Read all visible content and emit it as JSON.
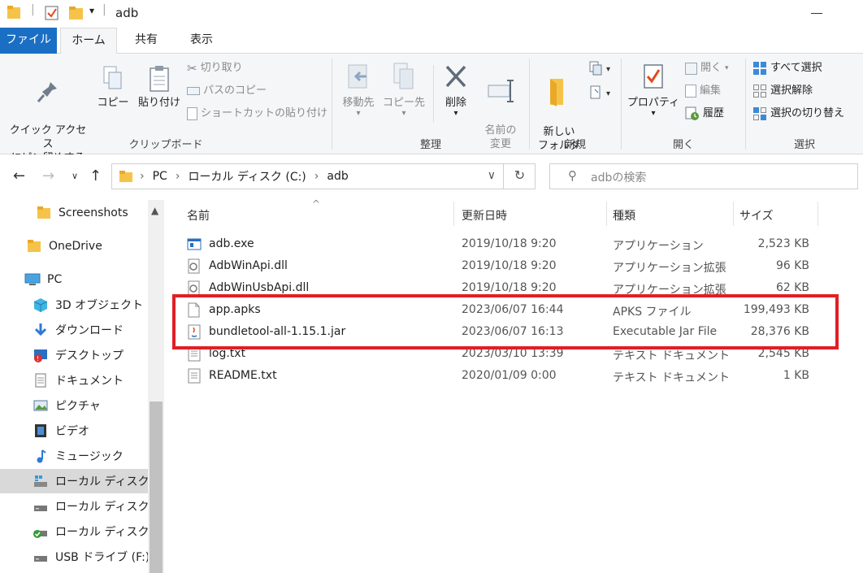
{
  "window": {
    "title": "adb"
  },
  "tabs": {
    "file": "ファイル",
    "home": "ホーム",
    "share": "共有",
    "view": "表示"
  },
  "ribbon": {
    "clipboard": {
      "label": "クリップボード",
      "pin": "クイック アクセス\nにピン留めする",
      "copy": "コピー",
      "paste": "貼り付け",
      "cut": "切り取り",
      "copy_path": "パスのコピー",
      "paste_shortcut": "ショートカットの貼り付け"
    },
    "organize": {
      "label": "整理",
      "move_to": "移動先",
      "copy_to": "コピー先",
      "delete": "削除",
      "rename": "名前の\n変更"
    },
    "new": {
      "label": "新規",
      "new_folder": "新しい\nフォルダー"
    },
    "open": {
      "label": "開く",
      "properties": "プロパティ",
      "open": "開く",
      "edit": "編集",
      "history": "履歴"
    },
    "select": {
      "label": "選択",
      "select_all": "すべて選択",
      "select_none": "選択解除",
      "invert": "選択の切り替え"
    }
  },
  "address": {
    "crumbs": [
      "PC",
      "ローカル ディスク (C:)",
      "adb"
    ],
    "search_placeholder": "adbの検索"
  },
  "nav": {
    "items": [
      "Screenshots",
      "OneDrive",
      "PC",
      "3D オブジェクト",
      "ダウンロード",
      "デスクトップ",
      "ドキュメント",
      "ピクチャ",
      "ビデオ",
      "ミュージック",
      "ローカル ディスク (C",
      "ローカル ディスク (D",
      "ローカル ディスク (E",
      "USB ドライブ (F:)"
    ]
  },
  "columns": {
    "name": "名前",
    "date": "更新日時",
    "type": "種類",
    "size": "サイズ"
  },
  "files": [
    {
      "name": "adb.exe",
      "date": "2019/10/18 9:20",
      "type": "アプリケーション",
      "size": "2,523 KB",
      "icon": "exe-icon"
    },
    {
      "name": "AdbWinApi.dll",
      "date": "2019/10/18 9:20",
      "type": "アプリケーション拡張",
      "size": "96 KB",
      "icon": "dll-icon"
    },
    {
      "name": "AdbWinUsbApi.dll",
      "date": "2019/10/18 9:20",
      "type": "アプリケーション拡張",
      "size": "62 KB",
      "icon": "dll-icon"
    },
    {
      "name": "app.apks",
      "date": "2023/06/07 16:44",
      "type": "APKS ファイル",
      "size": "199,493 KB",
      "icon": "file-icon"
    },
    {
      "name": "bundletool-all-1.15.1.jar",
      "date": "2023/06/07 16:13",
      "type": "Executable Jar File",
      "size": "28,376 KB",
      "icon": "jar-icon"
    },
    {
      "name": "log.txt",
      "date": "2023/03/10 13:39",
      "type": "テキスト ドキュメント",
      "size": "2,545 KB",
      "icon": "text-icon"
    },
    {
      "name": "README.txt",
      "date": "2020/01/09 0:00",
      "type": "テキスト ドキュメント",
      "size": "1 KB",
      "icon": "text-icon"
    }
  ],
  "colors": {
    "accent": "#1a6fc4",
    "highlight": "#e21e26",
    "folder": "#f6c34a"
  }
}
